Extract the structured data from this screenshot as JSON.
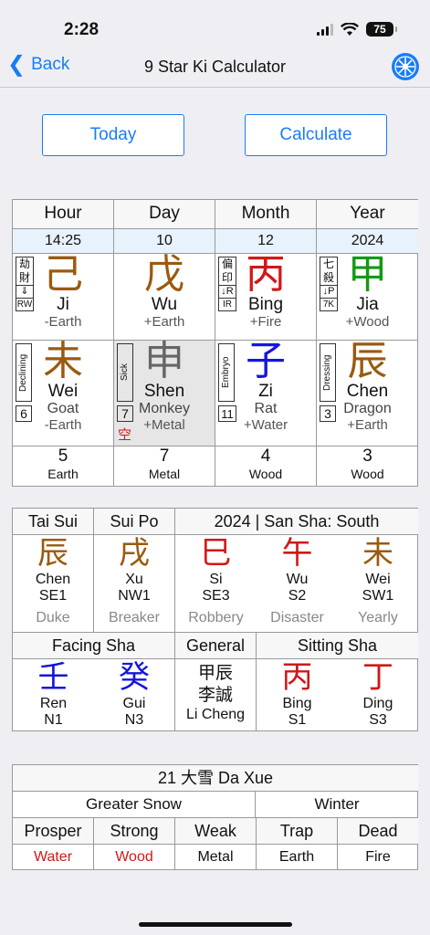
{
  "status": {
    "time": "2:28",
    "battery": "75"
  },
  "nav": {
    "back": "Back",
    "title": "9 Star Ki Calculator",
    "icon": "settings-wheel-icon"
  },
  "buttons": {
    "today": "Today",
    "calculate": "Calculate"
  },
  "pillars": {
    "headers": [
      "Hour",
      "Day",
      "Month",
      "Year"
    ],
    "values": [
      "14:25",
      "10",
      "12",
      "2024"
    ],
    "stems": [
      {
        "char": "己",
        "pinyin": "Ji",
        "element": "-Earth",
        "color": "#9a5a0f",
        "tag": "劫財",
        "arrow": "⇓",
        "code": "RW"
      },
      {
        "char": "戊",
        "pinyin": "Wu",
        "element": "+Earth",
        "color": "#9a5a0f"
      },
      {
        "char": "丙",
        "pinyin": "Bing",
        "element": "+Fire",
        "color": "#d01818",
        "tag": "偏印",
        "arrow": "↓R",
        "code": "IR"
      },
      {
        "char": "甲",
        "pinyin": "Jia",
        "element": "+Wood",
        "color": "#139a13",
        "tag": "七殺",
        "arrow": "↓P",
        "code": "7K"
      }
    ],
    "branches": [
      {
        "char": "未",
        "pinyin": "Wei",
        "animal": "Goat",
        "element": "-Earth",
        "color": "#9a5a0f",
        "stage": "Declining",
        "num": "6"
      },
      {
        "char": "申",
        "pinyin": "Shen",
        "animal": "Monkey",
        "element": "+Metal",
        "color": "#666666",
        "stage": "Sick",
        "num": "7",
        "void": "空"
      },
      {
        "char": "子",
        "pinyin": "Zi",
        "animal": "Rat",
        "element": "+Water",
        "color": "#1515dd",
        "stage": "Embryo",
        "num": "11"
      },
      {
        "char": "辰",
        "pinyin": "Chen",
        "animal": "Dragon",
        "element": "+Earth",
        "color": "#9a5a0f",
        "stage": "Dressing",
        "num": "3"
      }
    ],
    "stars": [
      {
        "num": "5",
        "element": "Earth"
      },
      {
        "num": "7",
        "element": "Metal"
      },
      {
        "num": "4",
        "element": "Wood"
      },
      {
        "num": "3",
        "element": "Wood"
      }
    ]
  },
  "sha": {
    "h_taisui": "Tai Sui",
    "h_suipo": "Sui Po",
    "h_sansha": "2024  |  San Sha: South",
    "cols": [
      {
        "char": "辰",
        "pinyin": "Chen",
        "dir": "SE1",
        "label": "Duke",
        "color": "#9a5a0f"
      },
      {
        "char": "戌",
        "pinyin": "Xu",
        "dir": "NW1",
        "label": "Breaker",
        "color": "#9a5a0f"
      },
      {
        "char": "巳",
        "pinyin": "Si",
        "dir": "SE3",
        "label": "Robbery",
        "color": "#d01818"
      },
      {
        "char": "午",
        "pinyin": "Wu",
        "dir": "S2",
        "label": "Disaster",
        "color": "#d01818"
      },
      {
        "char": "未",
        "pinyin": "Wei",
        "dir": "SW1",
        "label": "Yearly",
        "color": "#9a5a0f"
      }
    ],
    "h_facing": "Facing Sha",
    "h_general": "General",
    "h_sitting": "Sitting Sha",
    "facing": [
      {
        "char": "壬",
        "pinyin": "Ren",
        "dir": "N1",
        "color": "#1515dd"
      },
      {
        "char": "癸",
        "pinyin": "Gui",
        "dir": "N3",
        "color": "#1515dd"
      }
    ],
    "general": {
      "line1": "甲辰",
      "line2": "李誠",
      "line3": "Li Cheng"
    },
    "sitting": [
      {
        "char": "丙",
        "pinyin": "Bing",
        "dir": "S1",
        "color": "#d01818"
      },
      {
        "char": "丁",
        "pinyin": "Ding",
        "dir": "S3",
        "color": "#d01818"
      }
    ]
  },
  "term": {
    "title": "21 大雪 Da Xue",
    "name": "Greater Snow",
    "season": "Winter",
    "phases": [
      "Prosper",
      "Strong",
      "Weak",
      "Trap",
      "Dead"
    ],
    "elements": [
      "Water",
      "Wood",
      "Metal",
      "Earth",
      "Fire"
    ]
  }
}
